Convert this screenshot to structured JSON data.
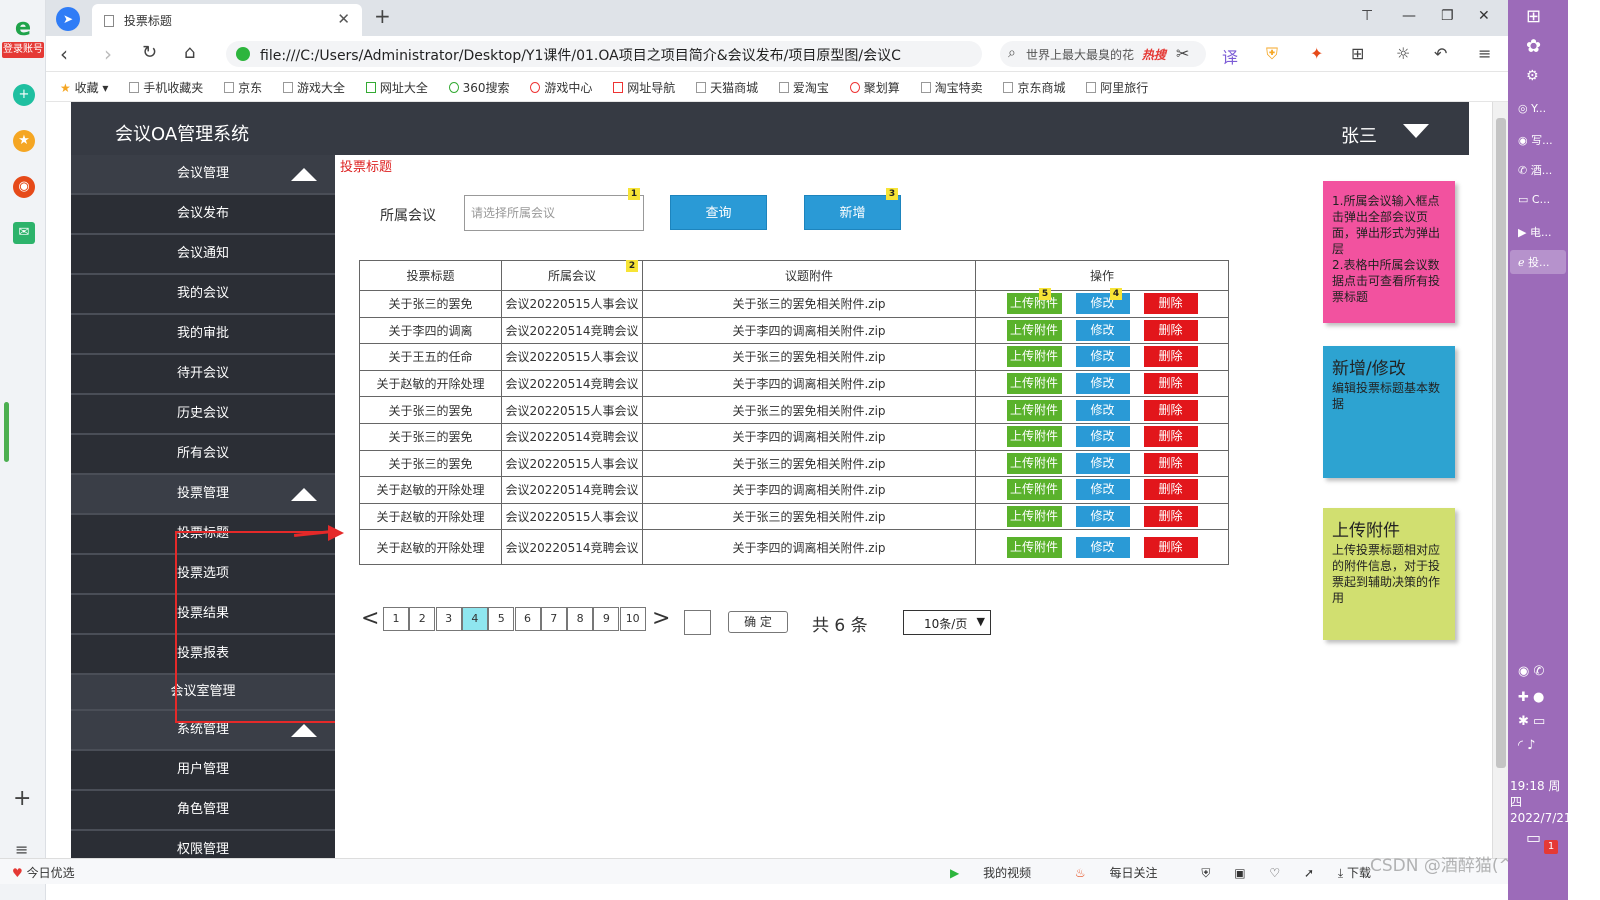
{
  "browser": {
    "tab_title": "投票标题",
    "url": "file:///C:/Users/Administrator/Desktop/Y1课件/01.OA项目之项目简介&会议发布/项目原型图/会议C",
    "search_text": "世界上最大最臭的花",
    "search_hot": "热搜",
    "side_badge": "登录账号",
    "bookmarks": [
      "收藏",
      "手机收藏夹",
      "京东",
      "游戏大全",
      "网址大全",
      "360搜索",
      "游戏中心",
      "网址导航",
      "天猫商城",
      "爱淘宝",
      "聚划算",
      "淘宝特卖",
      "京东商城",
      "阿里旅行"
    ]
  },
  "app": {
    "title": "会议OA管理系统",
    "user": "张三"
  },
  "sidebar": {
    "items": [
      {
        "label": "会议管理",
        "group": true
      },
      {
        "label": "会议发布"
      },
      {
        "label": "会议通知"
      },
      {
        "label": "我的会议"
      },
      {
        "label": "我的审批"
      },
      {
        "label": "待开会议"
      },
      {
        "label": "历史会议"
      },
      {
        "label": "所有会议"
      },
      {
        "label": "投票管理",
        "group": true
      },
      {
        "label": "投票标题"
      },
      {
        "label": "投票选项"
      },
      {
        "label": "投票结果"
      },
      {
        "label": "投票报表"
      },
      {
        "label": "会议室管理",
        "group": true
      },
      {
        "label": "系统管理",
        "group": true
      },
      {
        "label": "用户管理"
      },
      {
        "label": "角色管理"
      },
      {
        "label": "权限管理"
      }
    ]
  },
  "content": {
    "breadcrumb": "投票标题",
    "filter_label": "所属会议",
    "filter_placeholder": "请选择所属会议",
    "query_button": "查询",
    "add_button": "新增",
    "markers": [
      "1",
      "2",
      "3",
      "4",
      "5"
    ]
  },
  "table": {
    "headers": [
      "投票标题",
      "所属会议",
      "议题附件",
      "操作"
    ],
    "actions": {
      "upload": "上传附件",
      "edit": "修改",
      "delete": "删除"
    },
    "rows": [
      [
        "关于张三的罢免",
        "会议20220515人事会议",
        "关于张三的罢免相关附件.zip"
      ],
      [
        "关于李四的调离",
        "会议20220514竞聘会议",
        "关于李四的调离相关附件.zip"
      ],
      [
        "关于王五的任命",
        "会议20220515人事会议",
        "关于张三的罢免相关附件.zip"
      ],
      [
        "关于赵敏的开除处理",
        "会议20220514竞聘会议",
        "关于李四的调离相关附件.zip"
      ],
      [
        "关于张三的罢免",
        "会议20220515人事会议",
        "关于张三的罢免相关附件.zip"
      ],
      [
        "关于张三的罢免",
        "会议20220514竞聘会议",
        "关于李四的调离相关附件.zip"
      ],
      [
        "关于张三的罢免",
        "会议20220515人事会议",
        "关于张三的罢免相关附件.zip"
      ],
      [
        "关于赵敏的开除处理",
        "会议20220514竞聘会议",
        "关于李四的调离相关附件.zip"
      ],
      [
        "关于赵敏的开除处理",
        "会议20220515人事会议",
        "关于张三的罢免相关附件.zip"
      ],
      [
        "关于赵敏的开除处理",
        "会议20220514竞聘会议",
        "关于李四的调离相关附件.zip"
      ]
    ]
  },
  "pagination": {
    "prev": "<",
    "next": ">",
    "pages": [
      "1",
      "2",
      "3",
      "4",
      "5",
      "6",
      "7",
      "8",
      "9",
      "10"
    ],
    "current_page": "4",
    "confirm": "确 定",
    "total": "共 6 条",
    "page_size": "10条/页"
  },
  "notes": {
    "pink": "1.所属会议输入框点击弹出全部会议页面，弹出形式为弹出层\n2.表格中所属会议数据点击可查看所有投票标题",
    "blue_title": "新增/修改",
    "blue_text": "编辑投票标题基本数据",
    "green_title": "上传附件",
    "green_text": "上传投票标题相对应的附件信息，对于投票起到辅助决策的作用"
  },
  "statusbar": {
    "left": "今日优选",
    "items": [
      "我的视频",
      "每日关注",
      "下载"
    ],
    "watermark": "CSDN @酒醉猫(^・ω・^)"
  },
  "taskbar": {
    "apps": [
      "Y...",
      "写...",
      "酒...",
      "C...",
      "电...",
      "投..."
    ],
    "time": "19:18 周四",
    "date": "2022/7/21",
    "badge": "1"
  },
  "colors": {
    "header_bg": "#363a43",
    "sidebar_bg": "#2b2e35",
    "primary_blue": "#2a9ad6",
    "upload_green": "#5ab22c",
    "delete_red": "#e2161b",
    "active_page": "#8fe6ef",
    "highlight_red": "#e52929"
  }
}
